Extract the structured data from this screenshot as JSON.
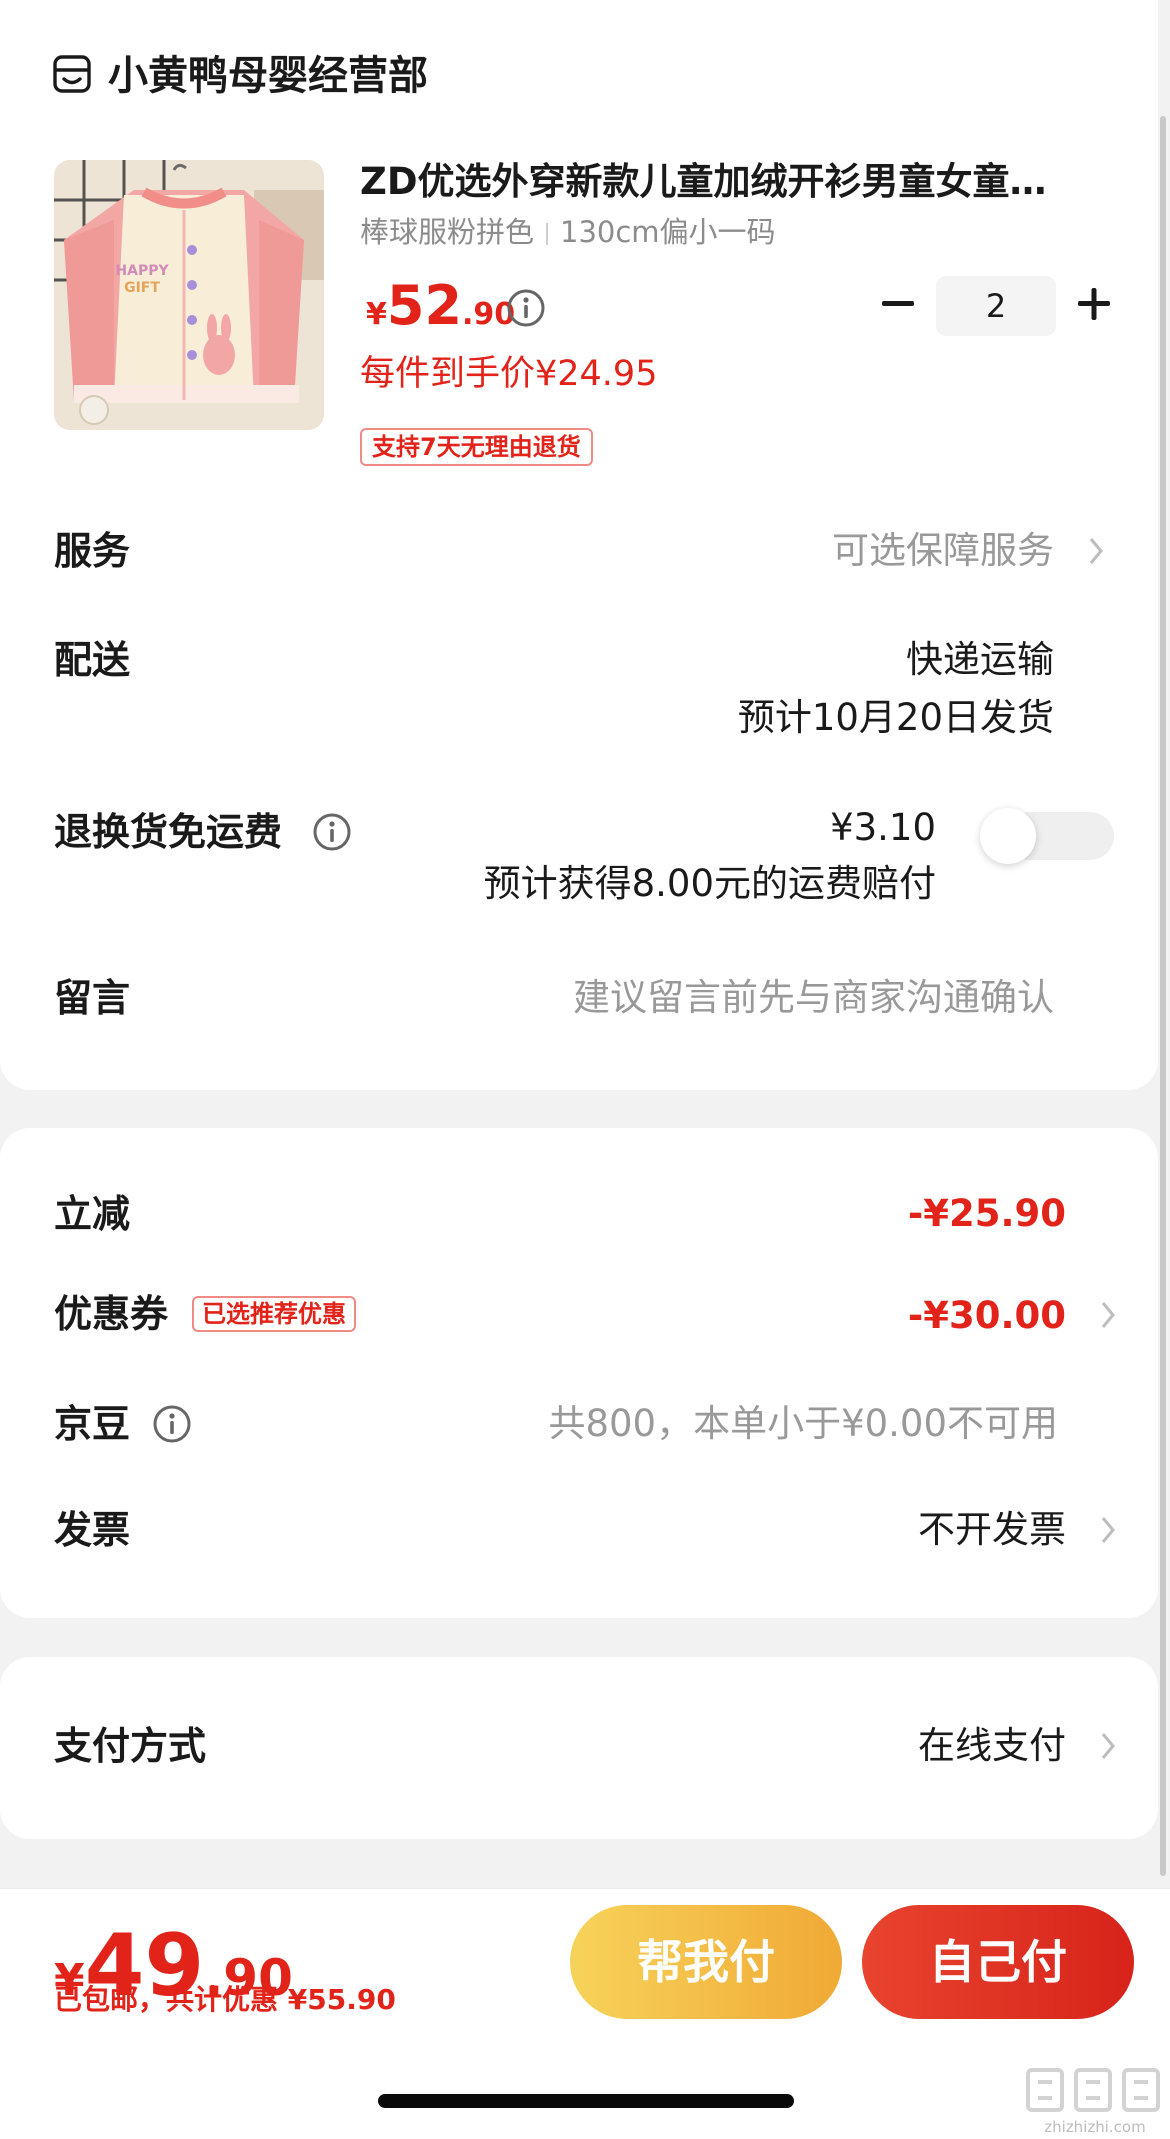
{
  "store": {
    "name": "小黄鸭母婴经营部",
    "icon": "store-icon"
  },
  "product": {
    "title": "ZD优选外穿新款儿童加绒开衫男童女童…",
    "spec": [
      "棒球服粉拼色",
      "130cm偏小一码"
    ],
    "price": {
      "currency": "¥",
      "integer": "52",
      "decimal": ".90"
    },
    "per_price": "每件到手价¥24.95",
    "return_badge": "支持7天无理由退货",
    "image_text": "HAPPY GIFT",
    "quantity": "2"
  },
  "rows": {
    "service": {
      "label": "服务",
      "value": "可选保障服务"
    },
    "delivery": {
      "label": "配送",
      "method": "快递运输",
      "eta": "预计10月20日发货"
    },
    "return_shipping": {
      "label": "退换货免运费",
      "price": "¥3.10",
      "compensation": "预计获得8.00元的运费赔付",
      "enabled": false
    },
    "message": {
      "label": "留言",
      "placeholder": "建议留言前先与商家沟通确认"
    }
  },
  "discounts": {
    "instant": {
      "label": "立减",
      "value": "-¥25.90"
    },
    "coupon": {
      "label": "优惠券",
      "badge": "已选推荐优惠",
      "value": "-¥30.00"
    },
    "jingdou": {
      "label": "京豆",
      "value": "共800，本单小于¥0.00不可用"
    },
    "invoice": {
      "label": "发票",
      "value": "不开发票"
    }
  },
  "payment": {
    "label": "支付方式",
    "value": "在线支付"
  },
  "footer": {
    "total": {
      "currency": "¥",
      "integer": "49",
      "decimal": ".90"
    },
    "note": "已包邮，共计优惠 ¥55.90",
    "help_pay": "帮我付",
    "self_pay": "自己付"
  },
  "watermark": "zhizhizhi.com",
  "colors": {
    "accent": "#e2231a",
    "help_button": "#f0b53e",
    "self_button": "#dd2f22"
  }
}
